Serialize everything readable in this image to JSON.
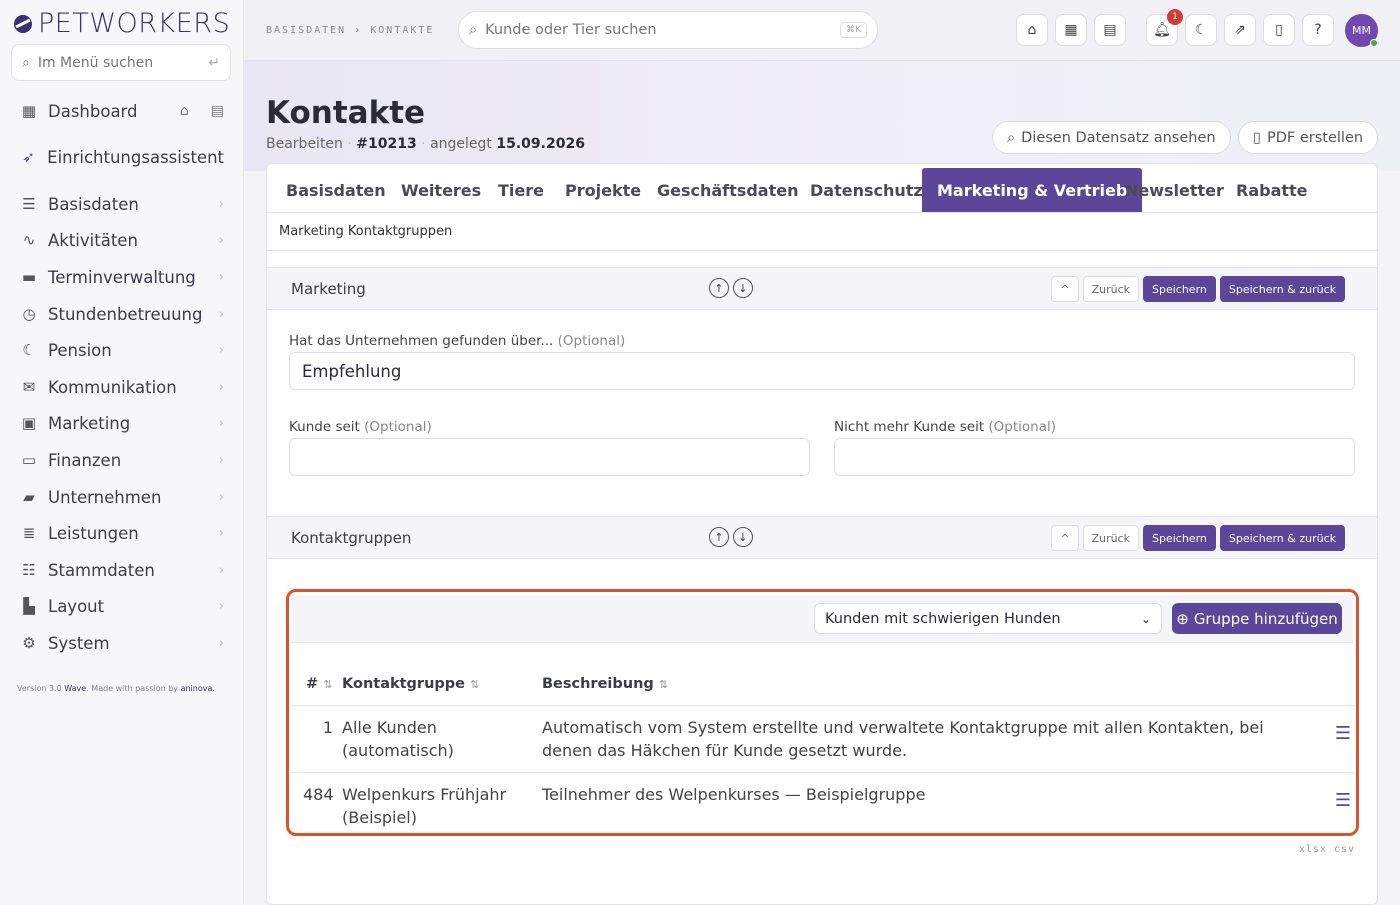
{
  "brand": {
    "logo_text": "PETWORKERS"
  },
  "sidebar": {
    "search_placeholder": "Im Menü suchen",
    "items": [
      {
        "label": "Dashboard"
      },
      {
        "label": "Einrichtungsassistent"
      },
      {
        "label": "Basisdaten"
      },
      {
        "label": "Aktivitäten"
      },
      {
        "label": "Terminverwaltung"
      },
      {
        "label": "Stundenbetreuung"
      },
      {
        "label": "Pension"
      },
      {
        "label": "Kommunikation"
      },
      {
        "label": "Marketing"
      },
      {
        "label": "Finanzen"
      },
      {
        "label": "Unternehmen"
      },
      {
        "label": "Leistungen"
      },
      {
        "label": "Stammdaten"
      },
      {
        "label": "Layout"
      },
      {
        "label": "System"
      }
    ],
    "version_prefix": "Version 3.0",
    "version_name": "Wave",
    "version_mid": ". Made with passion by",
    "version_company": "aninova."
  },
  "topbar": {
    "breadcrumb": "BASISDATEN › KONTAKTE",
    "search_placeholder": "Kunde oder Tier suchen",
    "search_shortcut": "⌘K",
    "notification_count": "1",
    "help_label": "?",
    "avatar_initials": "MM"
  },
  "header": {
    "title": "Kontakte",
    "mode": "Bearbeiten",
    "record_id": "#10213",
    "created_label": "angelegt",
    "created_date": "15.09.2026",
    "view_button": "Diesen Datensatz ansehen",
    "pdf_button": "PDF erstellen"
  },
  "tabs": [
    {
      "label": "Basisdaten"
    },
    {
      "label": "Weiteres"
    },
    {
      "label": "Tiere"
    },
    {
      "label": "Projekte"
    },
    {
      "label": "Geschäftsdaten"
    },
    {
      "label": "Datenschutz"
    },
    {
      "label": "Marketing & Vertrieb",
      "active": true
    },
    {
      "label": "Newsletter"
    },
    {
      "label": "Rabatte"
    }
  ],
  "section_bar": "Marketing Kontaktgruppen",
  "panel_buttons": {
    "collapse": "^",
    "back": "Zurück",
    "save": "Speichern",
    "save_back": "Speichern & zurück"
  },
  "marketing": {
    "title": "Marketing",
    "found_label": "Hat das Unternehmen gefunden über...",
    "optional": "(Optional)",
    "found_value": "Empfehlung",
    "customer_since_label": "Kunde seit",
    "customer_since_value": "",
    "no_longer_label": "Nicht mehr Kunde seit",
    "no_longer_value": ""
  },
  "groups": {
    "title": "Kontaktgruppen",
    "selected_group": "Kunden mit schwierigen Hunden",
    "add_button": "Gruppe hinzufügen",
    "columns": {
      "num": "#",
      "group": "Kontaktgruppe",
      "desc": "Beschreibung"
    },
    "rows": [
      {
        "num": "1",
        "group_line1": "Alle Kunden",
        "group_line2": "(automatisch)",
        "desc_line1": "Automatisch vom System erstellte und verwaltete Kontaktgruppe mit allen Kontakten, bei",
        "desc_line2": "denen das Häkchen für Kunde gesetzt wurde."
      },
      {
        "num": "484",
        "group_line1": "Welpenkurs Frühjahr",
        "group_line2": "(Beispiel)",
        "desc_line1": "Teilnehmer des Welpenkurses — Beispielgruppe",
        "desc_line2": ""
      }
    ],
    "export_xlsx": "xlsx",
    "export_csv": "csv"
  },
  "colors": {
    "accent": "#5a479a",
    "highlight": "#d9542e",
    "badge": "#d23c32"
  }
}
